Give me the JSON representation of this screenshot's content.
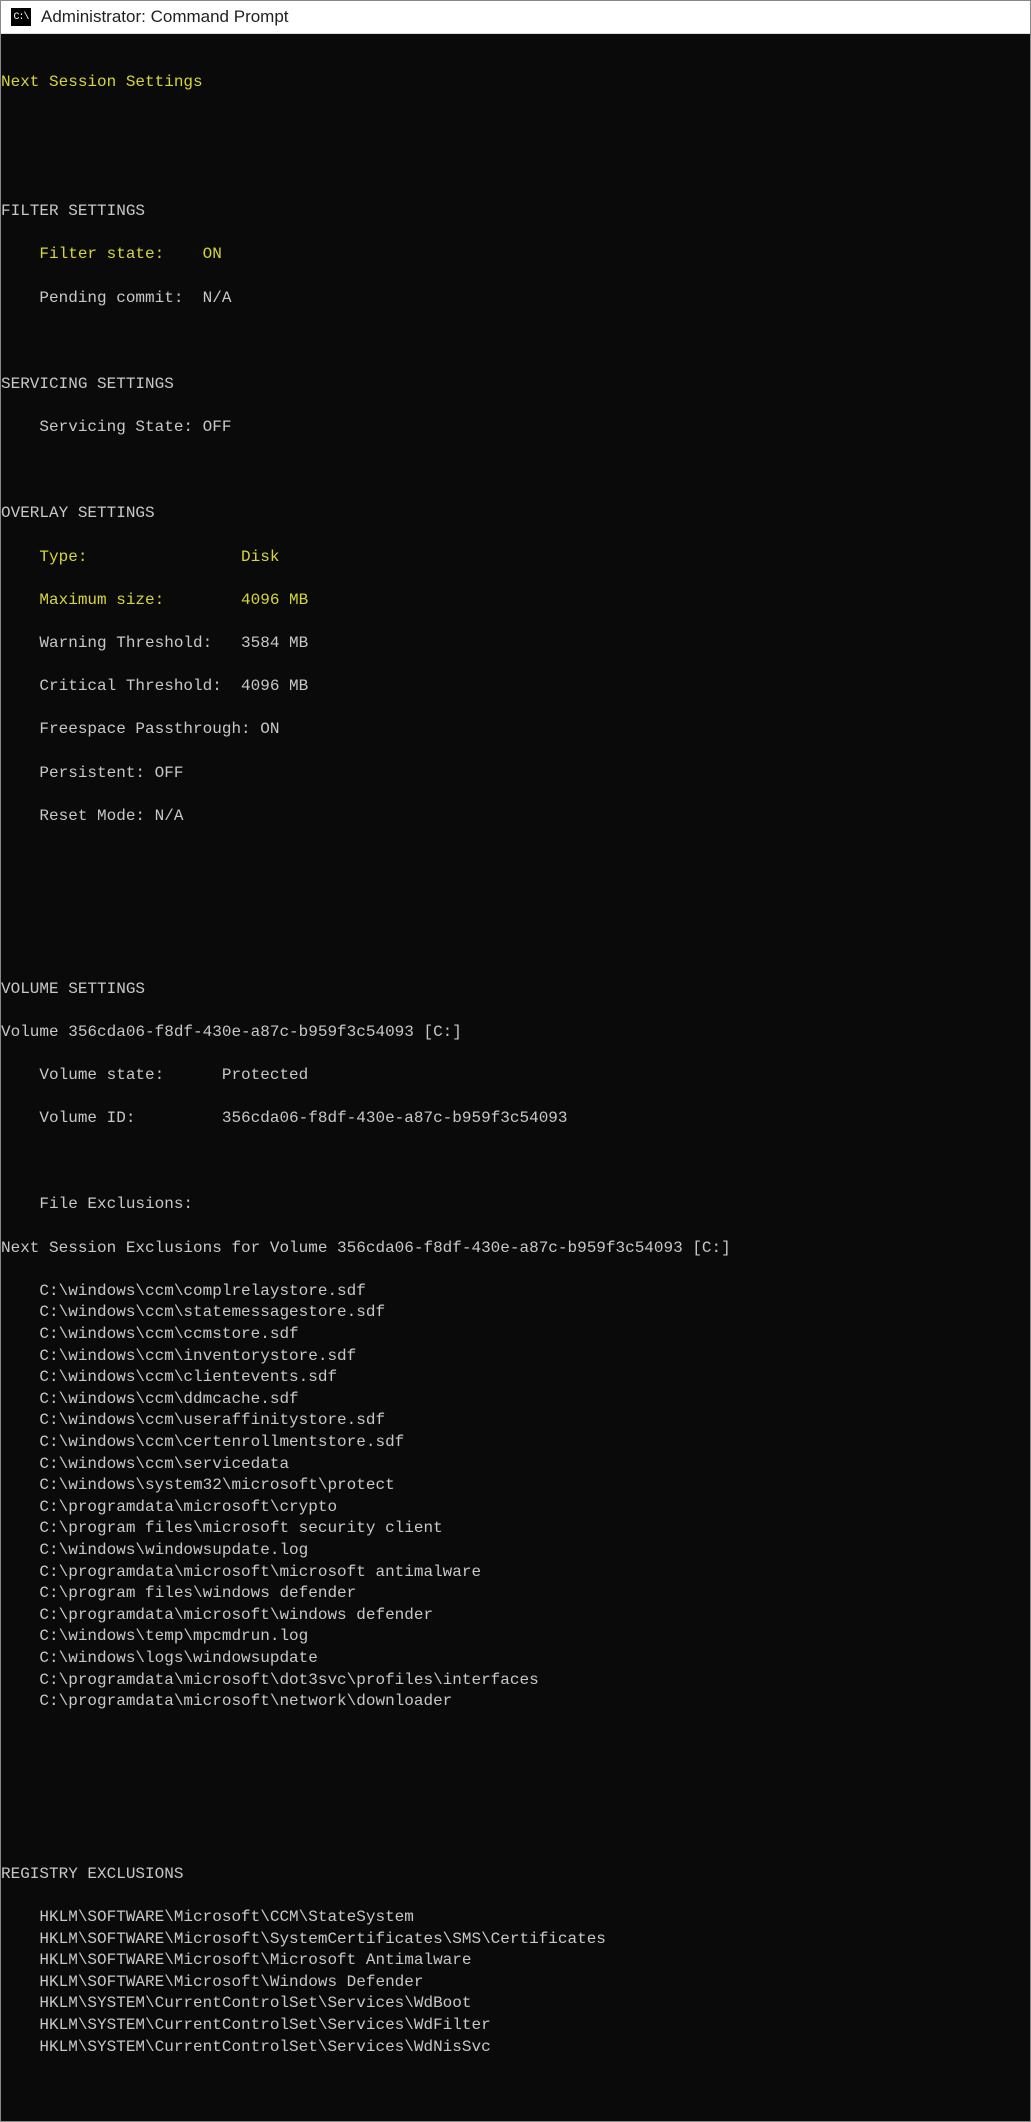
{
  "title": "Administrator: Command Prompt",
  "header": "Next Session Settings",
  "filter": {
    "heading": "FILTER SETTINGS",
    "state_label": "Filter state:",
    "state_value": "ON",
    "pending_label": "Pending commit:",
    "pending_value": "N/A"
  },
  "servicing": {
    "heading": "SERVICING SETTINGS",
    "state_label": "Servicing State:",
    "state_value": "OFF"
  },
  "overlay": {
    "heading": "OVERLAY SETTINGS",
    "type_label": "Type:",
    "type_value": "Disk",
    "maxsize_label": "Maximum size:",
    "maxsize_value": "4096 MB",
    "warn_label": "Warning Threshold:",
    "warn_value": "3584 MB",
    "crit_label": "Critical Threshold:",
    "crit_value": "4096 MB",
    "freespace_label": "Freespace Passthrough:",
    "freespace_value": "ON",
    "persistent_label": "Persistent:",
    "persistent_value": "OFF",
    "reset_label": "Reset Mode:",
    "reset_value": "N/A"
  },
  "volume": {
    "heading": "VOLUME SETTINGS",
    "volume_line": "Volume 356cda06-f8df-430e-a87c-b959f3c54093 [C:]",
    "state_label": "Volume state:",
    "state_value": "Protected",
    "id_label": "Volume ID:",
    "id_value": "356cda06-f8df-430e-a87c-b959f3c54093",
    "file_excl_label": "File Exclusions:",
    "next_excl_line": "Next Session Exclusions for Volume 356cda06-f8df-430e-a87c-b959f3c54093 [C:]",
    "file_exclusions": [
      "C:\\windows\\ccm\\complrelaystore.sdf",
      "C:\\windows\\ccm\\statemessagestore.sdf",
      "C:\\windows\\ccm\\ccmstore.sdf",
      "C:\\windows\\ccm\\inventorystore.sdf",
      "C:\\windows\\ccm\\clientevents.sdf",
      "C:\\windows\\ccm\\ddmcache.sdf",
      "C:\\windows\\ccm\\useraffinitystore.sdf",
      "C:\\windows\\ccm\\certenrollmentstore.sdf",
      "C:\\windows\\ccm\\servicedata",
      "C:\\windows\\system32\\microsoft\\protect",
      "C:\\programdata\\microsoft\\crypto",
      "C:\\program files\\microsoft security client",
      "C:\\windows\\windowsupdate.log",
      "C:\\programdata\\microsoft\\microsoft antimalware",
      "C:\\program files\\windows defender",
      "C:\\programdata\\microsoft\\windows defender",
      "C:\\windows\\temp\\mpcmdrun.log",
      "C:\\windows\\logs\\windowsupdate",
      "C:\\programdata\\microsoft\\dot3svc\\profiles\\interfaces",
      "C:\\programdata\\microsoft\\network\\downloader"
    ]
  },
  "registry": {
    "heading": "REGISTRY EXCLUSIONS",
    "entries": [
      "HKLM\\SOFTWARE\\Microsoft\\CCM\\StateSystem",
      "HKLM\\SOFTWARE\\Microsoft\\SystemCertificates\\SMS\\Certificates",
      "HKLM\\SOFTWARE\\Microsoft\\Microsoft Antimalware",
      "HKLM\\SOFTWARE\\Microsoft\\Windows Defender",
      "HKLM\\SYSTEM\\CurrentControlSet\\Services\\WdBoot",
      "HKLM\\SYSTEM\\CurrentControlSet\\Services\\WdFilter",
      "HKLM\\SYSTEM\\CurrentControlSet\\Services\\WdNisSvc"
    ]
  }
}
